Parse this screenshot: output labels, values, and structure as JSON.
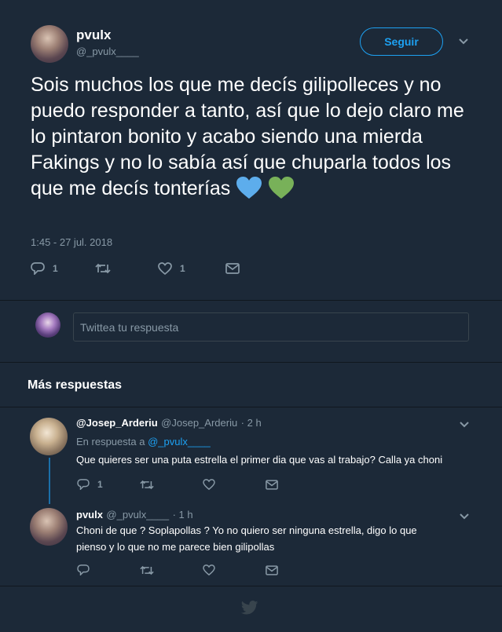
{
  "main_tweet": {
    "name": "pvulx",
    "handle": "@_pvulx____",
    "follow_label": "Seguir",
    "text": "Sois muchos los que me decís gilipolleces y no puedo responder a tanto, así que lo dejo claro me lo pintaron bonito y acabo siendo una mierda Fakings y no lo sabía así que chuparla todos los que me decís tonterías",
    "timestamp": "1:45 - 27 jul. 2018",
    "reply_count": "1",
    "retweet_count": "",
    "like_count": "1"
  },
  "reply_box": {
    "placeholder": "Twittea tu respuesta"
  },
  "more_replies": {
    "title": "Más respuestas"
  },
  "replies": [
    {
      "name": "@Josep_Arderiu",
      "handle": "@Josep_Arderiu",
      "time": "· 2 h",
      "in_reply_prefix": "En respuesta a",
      "in_reply_to": "@_pvulx____",
      "text": "Que quieres ser una puta estrella el primer dia que vas al trabajo? Calla ya choni",
      "reply_count": "1"
    },
    {
      "name": "pvulx",
      "handle": "@_pvulx____",
      "time": "· 1 h",
      "text_line1": "Choni de que ? Soplapollas ? Yo no quiero ser ninguna estrella, digo lo que",
      "text_line2": "pienso y lo que no me parece bien gilipollas"
    }
  ],
  "colors": {
    "background": "#1c2938",
    "accent": "#1da1f2",
    "muted": "#8899a6",
    "divider": "#10171e",
    "heart_blue": "#5dadec",
    "heart_green": "#78b159"
  },
  "icons": [
    "chevron-down-icon",
    "reply-icon",
    "retweet-icon",
    "like-icon",
    "message-icon",
    "blue-heart-icon",
    "green-heart-icon",
    "twitter-bird-icon"
  ]
}
